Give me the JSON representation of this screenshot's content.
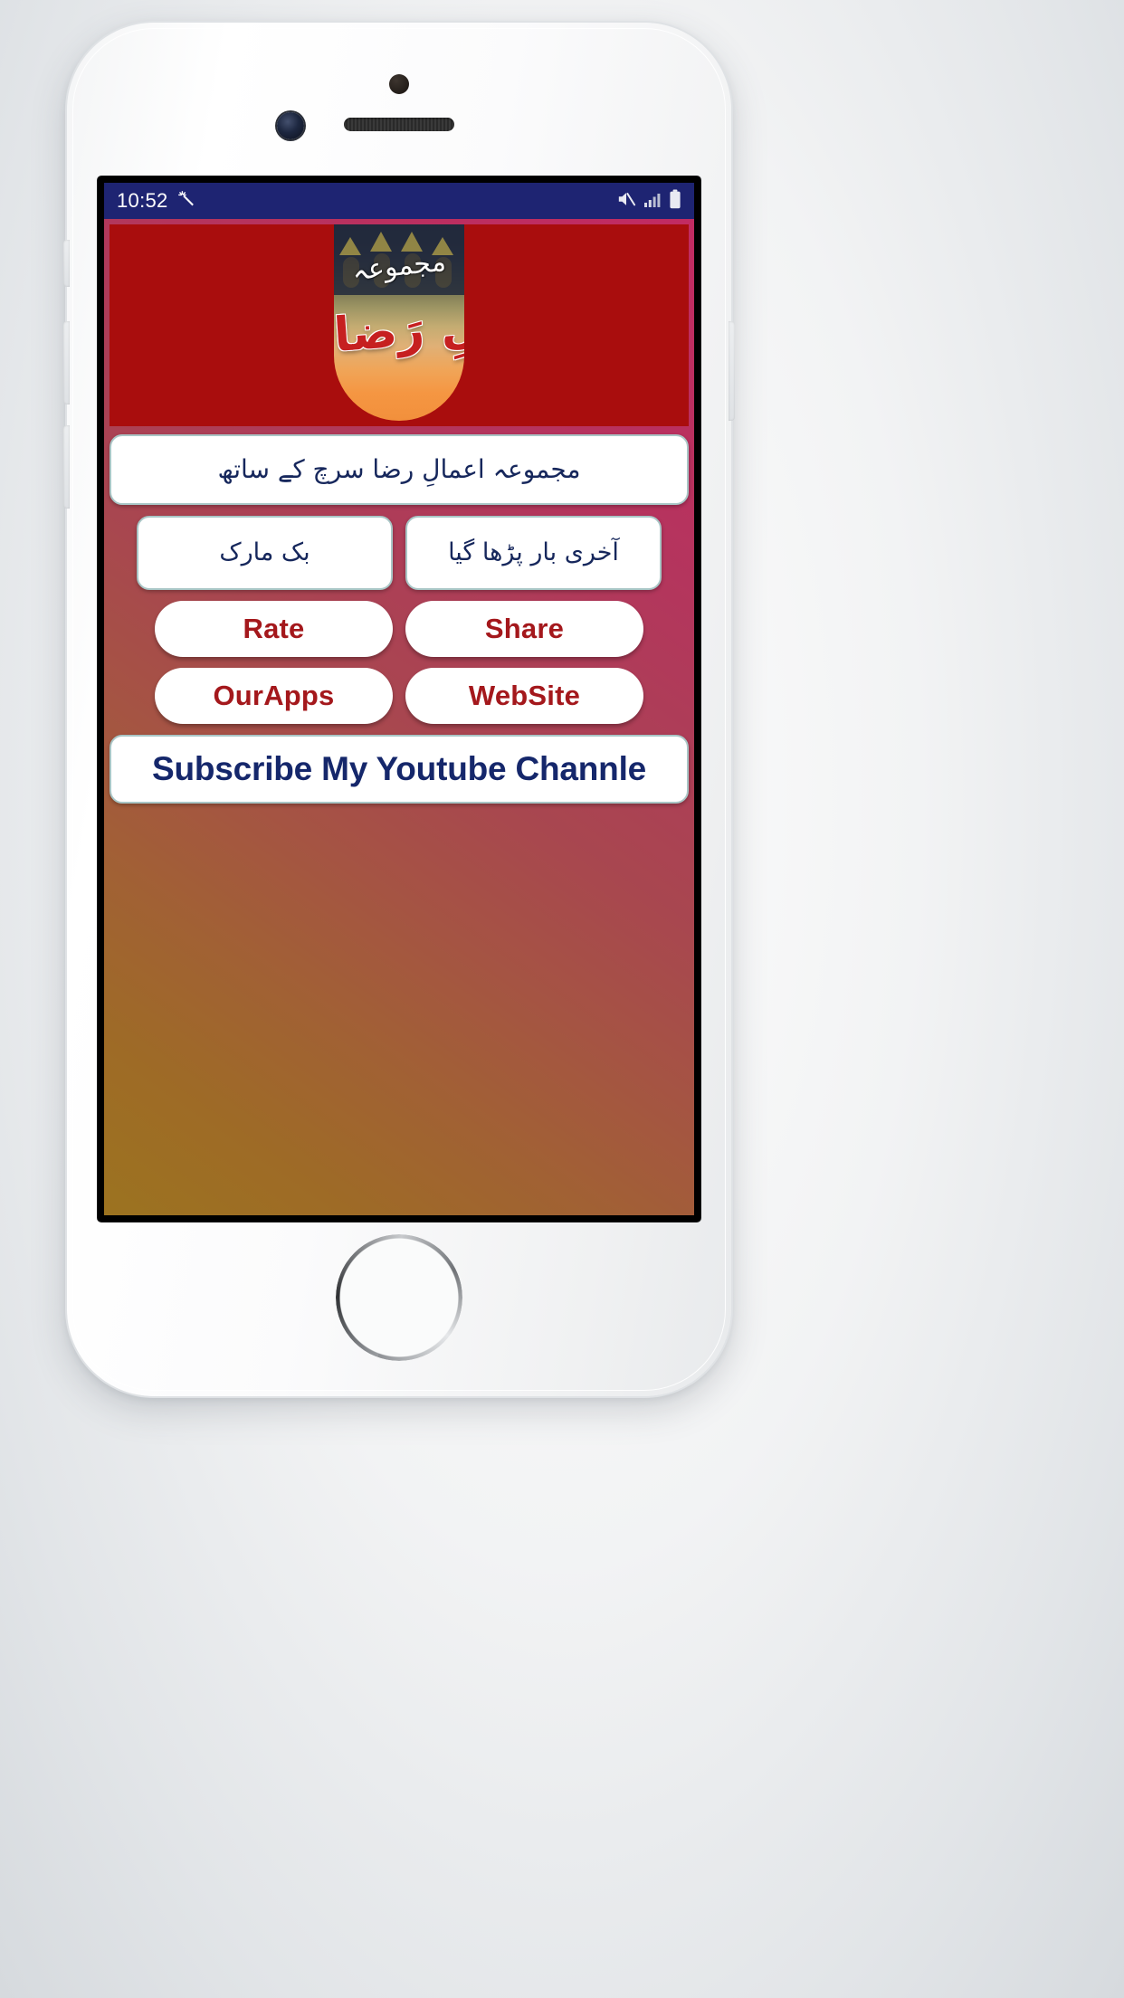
{
  "status_bar": {
    "time": "10:52",
    "left_icons": [
      "magic-wand-icon"
    ],
    "right_icons": [
      "mute-icon",
      "signal-bars-icon",
      "battery-icon"
    ],
    "background_color": "#1e2472",
    "text_color": "#ffffff"
  },
  "header": {
    "banner_color": "#a90d0d",
    "logo": {
      "name": "majmua-amal-e-raza-logo",
      "top_word": "مجموعہ",
      "main_word": "اَعمالِ رَضا",
      "top_word_color": "#ffffff",
      "main_word_color": "#c62020"
    }
  },
  "screen": {
    "background_gradient_start": "#c32a63",
    "background_gradient_end": "#9c7320"
  },
  "buttons": {
    "search_urdu": {
      "label": "مجموعہ اعمالِ رضا سرچ کے ساتھ",
      "text_color": "#16275c"
    },
    "bookmark": {
      "label": "بک مارک",
      "text_color": "#16275c"
    },
    "last_read": {
      "label": "آخری بار پڑھا گیا",
      "text_color": "#16275c"
    },
    "rate": {
      "label": "Rate",
      "text_color": "#a4181c"
    },
    "share": {
      "label": "Share",
      "text_color": "#a4181c"
    },
    "our_apps": {
      "label": "OurApps",
      "text_color": "#a4181c"
    },
    "website": {
      "label": "WebSite",
      "text_color": "#a4181c"
    },
    "youtube_subscribe": {
      "label": "Subscribe My Youtube Channle",
      "text_color": "#15276b"
    }
  },
  "device": {
    "frame_color": "#ffffff",
    "home_button": "home-button"
  }
}
